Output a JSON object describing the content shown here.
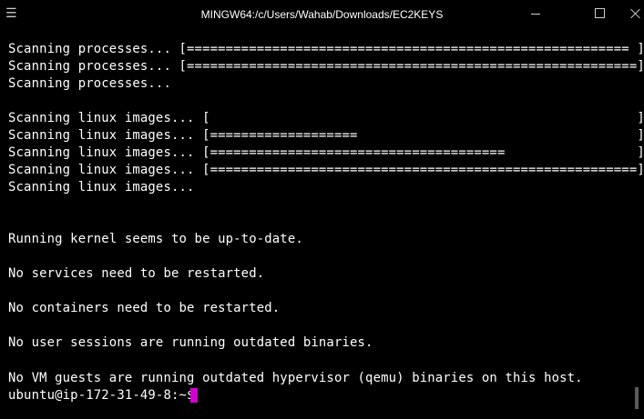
{
  "window": {
    "title": "MINGW64:/c/Users/Wahab/Downloads/EC2KEYS",
    "menu_icon": "hamburger-menu-icon",
    "controls": [
      "minimize-icon",
      "maximize-icon",
      "close-icon"
    ]
  },
  "terminal": {
    "lines": [
      "Scanning processes... [========================================================= ]",
      "Scanning processes... [==========================================================]",
      "Scanning processes...",
      "",
      "Scanning linux images... [                                                       ]",
      "Scanning linux images... [===================                                    ]",
      "Scanning linux images... [======================================                 ]",
      "Scanning linux images... [=======================================================]",
      "Scanning linux images...",
      "",
      "",
      "Running kernel seems to be up-to-date.",
      "",
      "No services need to be restarted.",
      "",
      "No containers need to be restarted.",
      "",
      "No user sessions are running outdated binaries.",
      "",
      "No VM guests are running outdated hypervisor (qemu) binaries on this host."
    ],
    "prompt": "ubuntu@ip-172-31-49-8:~$ ",
    "cursor_color": "#d100d1",
    "background": "#000000",
    "foreground": "#ffffff"
  }
}
